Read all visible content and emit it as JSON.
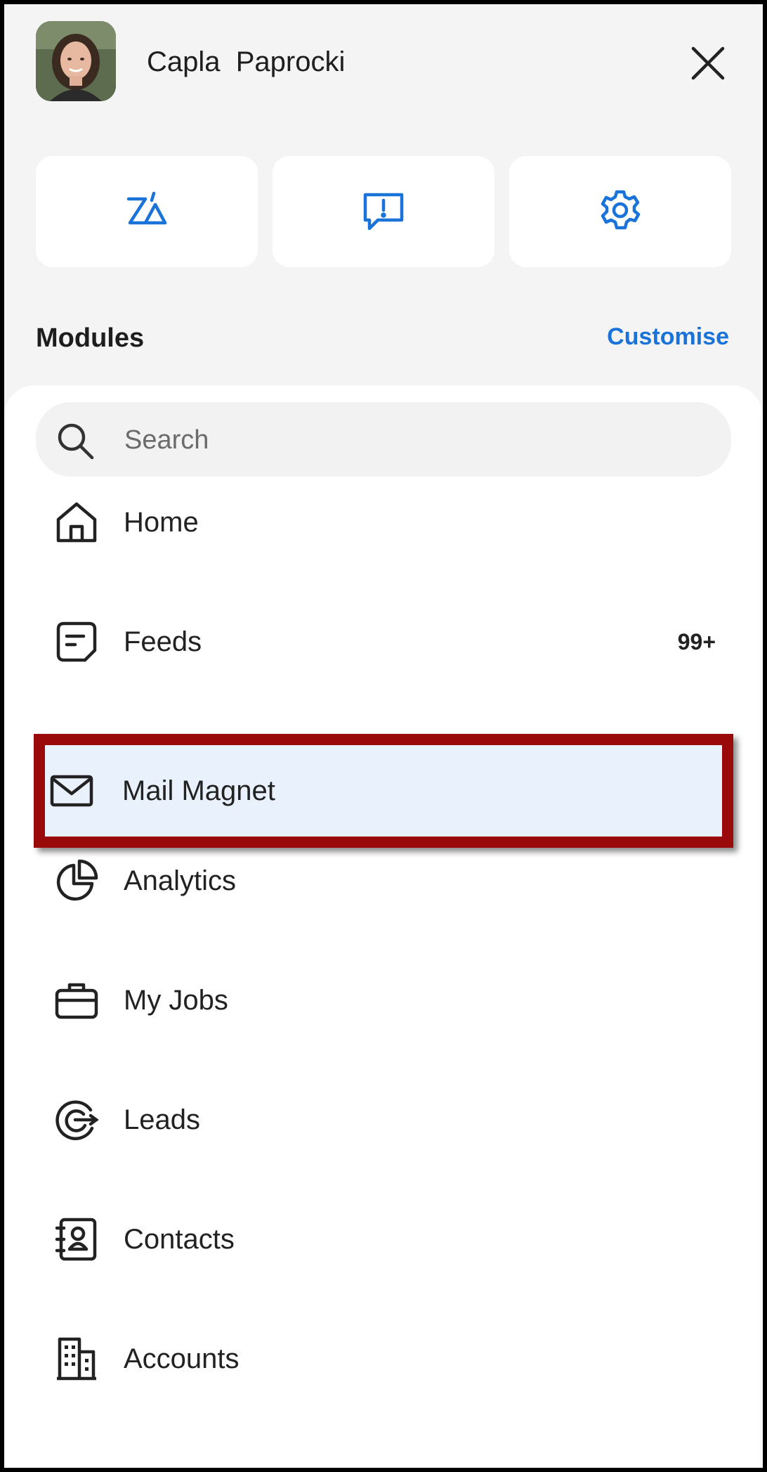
{
  "header": {
    "user_name": "Capla  Paprocki"
  },
  "quick_actions": [
    {
      "icon": "zia-icon"
    },
    {
      "icon": "feedback-icon"
    },
    {
      "icon": "settings-gear-icon"
    }
  ],
  "modules": {
    "title": "Modules",
    "customise_label": "Customise",
    "search_placeholder": "Search",
    "items": [
      {
        "label": "Home",
        "icon": "home-icon"
      },
      {
        "label": "Feeds",
        "icon": "feeds-icon",
        "count": "99+"
      },
      {
        "label": "Mail Magnet",
        "icon": "mail-icon",
        "highlighted": true
      },
      {
        "label": "Analytics",
        "icon": "pie-chart-icon"
      },
      {
        "label": "My Jobs",
        "icon": "briefcase-icon"
      },
      {
        "label": "Leads",
        "icon": "target-icon"
      },
      {
        "label": "Contacts",
        "icon": "contact-card-icon"
      },
      {
        "label": "Accounts",
        "icon": "building-icon"
      }
    ]
  },
  "colors": {
    "accent": "#1a73d9",
    "highlight_border": "#9a0a0a",
    "highlight_bg": "#e8f1fc",
    "background": "#f4f4f4"
  }
}
